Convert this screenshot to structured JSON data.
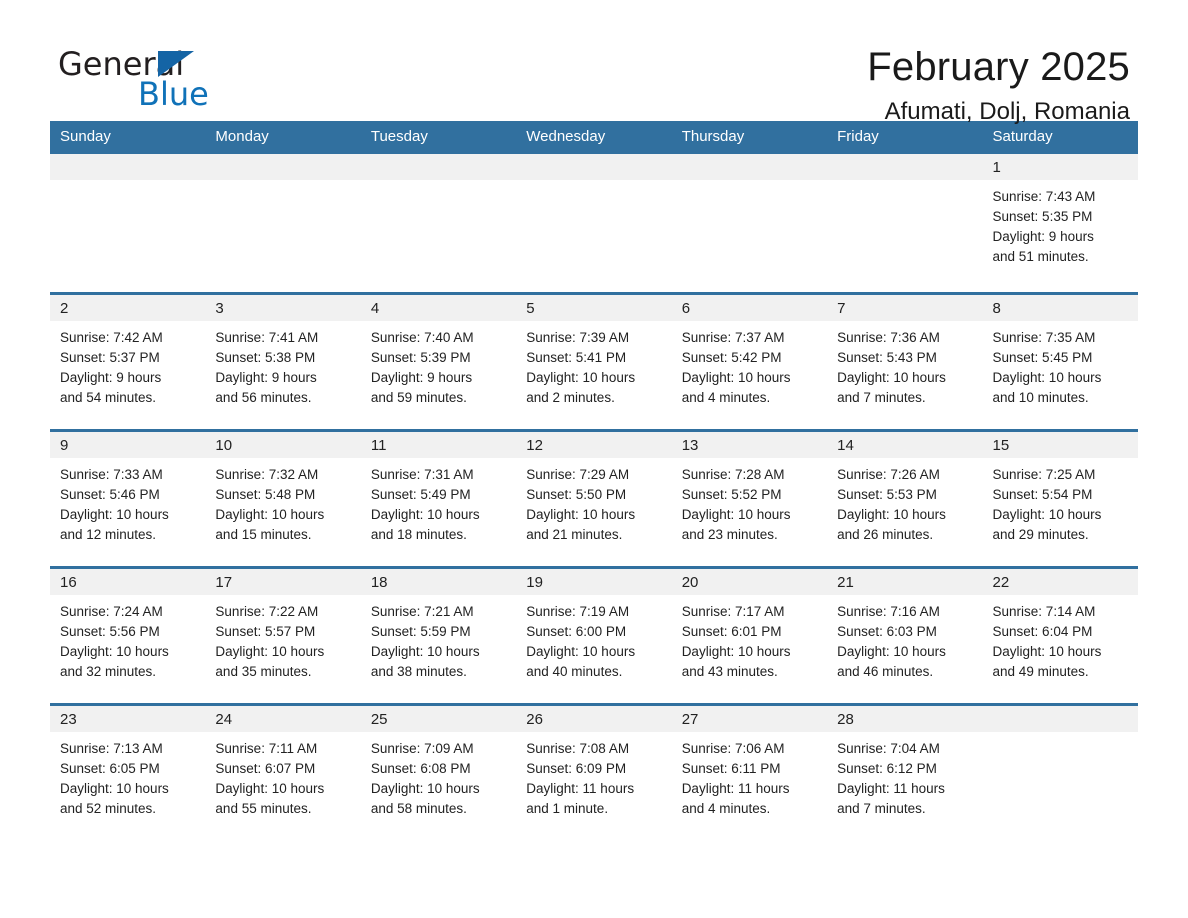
{
  "logo": {
    "part1": "General",
    "part2": "Blue",
    "triangle": "triangle-mark"
  },
  "header": {
    "month_title": "February 2025",
    "location": "Afumati, Dolj, Romania"
  },
  "calendar": {
    "weekdays": [
      "Sunday",
      "Monday",
      "Tuesday",
      "Wednesday",
      "Thursday",
      "Friday",
      "Saturday"
    ],
    "accent_color": "#31709f",
    "daynum_bg": "#f1f1f1",
    "weeks": [
      [
        {
          "day": "",
          "sunrise": "",
          "sunset": "",
          "daylight_line1": "",
          "daylight_line2": ""
        },
        {
          "day": "",
          "sunrise": "",
          "sunset": "",
          "daylight_line1": "",
          "daylight_line2": ""
        },
        {
          "day": "",
          "sunrise": "",
          "sunset": "",
          "daylight_line1": "",
          "daylight_line2": ""
        },
        {
          "day": "",
          "sunrise": "",
          "sunset": "",
          "daylight_line1": "",
          "daylight_line2": ""
        },
        {
          "day": "",
          "sunrise": "",
          "sunset": "",
          "daylight_line1": "",
          "daylight_line2": ""
        },
        {
          "day": "",
          "sunrise": "",
          "sunset": "",
          "daylight_line1": "",
          "daylight_line2": ""
        },
        {
          "day": "1",
          "sunrise": "Sunrise: 7:43 AM",
          "sunset": "Sunset: 5:35 PM",
          "daylight_line1": "Daylight: 9 hours",
          "daylight_line2": "and 51 minutes."
        }
      ],
      [
        {
          "day": "2",
          "sunrise": "Sunrise: 7:42 AM",
          "sunset": "Sunset: 5:37 PM",
          "daylight_line1": "Daylight: 9 hours",
          "daylight_line2": "and 54 minutes."
        },
        {
          "day": "3",
          "sunrise": "Sunrise: 7:41 AM",
          "sunset": "Sunset: 5:38 PM",
          "daylight_line1": "Daylight: 9 hours",
          "daylight_line2": "and 56 minutes."
        },
        {
          "day": "4",
          "sunrise": "Sunrise: 7:40 AM",
          "sunset": "Sunset: 5:39 PM",
          "daylight_line1": "Daylight: 9 hours",
          "daylight_line2": "and 59 minutes."
        },
        {
          "day": "5",
          "sunrise": "Sunrise: 7:39 AM",
          "sunset": "Sunset: 5:41 PM",
          "daylight_line1": "Daylight: 10 hours",
          "daylight_line2": "and 2 minutes."
        },
        {
          "day": "6",
          "sunrise": "Sunrise: 7:37 AM",
          "sunset": "Sunset: 5:42 PM",
          "daylight_line1": "Daylight: 10 hours",
          "daylight_line2": "and 4 minutes."
        },
        {
          "day": "7",
          "sunrise": "Sunrise: 7:36 AM",
          "sunset": "Sunset: 5:43 PM",
          "daylight_line1": "Daylight: 10 hours",
          "daylight_line2": "and 7 minutes."
        },
        {
          "day": "8",
          "sunrise": "Sunrise: 7:35 AM",
          "sunset": "Sunset: 5:45 PM",
          "daylight_line1": "Daylight: 10 hours",
          "daylight_line2": "and 10 minutes."
        }
      ],
      [
        {
          "day": "9",
          "sunrise": "Sunrise: 7:33 AM",
          "sunset": "Sunset: 5:46 PM",
          "daylight_line1": "Daylight: 10 hours",
          "daylight_line2": "and 12 minutes."
        },
        {
          "day": "10",
          "sunrise": "Sunrise: 7:32 AM",
          "sunset": "Sunset: 5:48 PM",
          "daylight_line1": "Daylight: 10 hours",
          "daylight_line2": "and 15 minutes."
        },
        {
          "day": "11",
          "sunrise": "Sunrise: 7:31 AM",
          "sunset": "Sunset: 5:49 PM",
          "daylight_line1": "Daylight: 10 hours",
          "daylight_line2": "and 18 minutes."
        },
        {
          "day": "12",
          "sunrise": "Sunrise: 7:29 AM",
          "sunset": "Sunset: 5:50 PM",
          "daylight_line1": "Daylight: 10 hours",
          "daylight_line2": "and 21 minutes."
        },
        {
          "day": "13",
          "sunrise": "Sunrise: 7:28 AM",
          "sunset": "Sunset: 5:52 PM",
          "daylight_line1": "Daylight: 10 hours",
          "daylight_line2": "and 23 minutes."
        },
        {
          "day": "14",
          "sunrise": "Sunrise: 7:26 AM",
          "sunset": "Sunset: 5:53 PM",
          "daylight_line1": "Daylight: 10 hours",
          "daylight_line2": "and 26 minutes."
        },
        {
          "day": "15",
          "sunrise": "Sunrise: 7:25 AM",
          "sunset": "Sunset: 5:54 PM",
          "daylight_line1": "Daylight: 10 hours",
          "daylight_line2": "and 29 minutes."
        }
      ],
      [
        {
          "day": "16",
          "sunrise": "Sunrise: 7:24 AM",
          "sunset": "Sunset: 5:56 PM",
          "daylight_line1": "Daylight: 10 hours",
          "daylight_line2": "and 32 minutes."
        },
        {
          "day": "17",
          "sunrise": "Sunrise: 7:22 AM",
          "sunset": "Sunset: 5:57 PM",
          "daylight_line1": "Daylight: 10 hours",
          "daylight_line2": "and 35 minutes."
        },
        {
          "day": "18",
          "sunrise": "Sunrise: 7:21 AM",
          "sunset": "Sunset: 5:59 PM",
          "daylight_line1": "Daylight: 10 hours",
          "daylight_line2": "and 38 minutes."
        },
        {
          "day": "19",
          "sunrise": "Sunrise: 7:19 AM",
          "sunset": "Sunset: 6:00 PM",
          "daylight_line1": "Daylight: 10 hours",
          "daylight_line2": "and 40 minutes."
        },
        {
          "day": "20",
          "sunrise": "Sunrise: 7:17 AM",
          "sunset": "Sunset: 6:01 PM",
          "daylight_line1": "Daylight: 10 hours",
          "daylight_line2": "and 43 minutes."
        },
        {
          "day": "21",
          "sunrise": "Sunrise: 7:16 AM",
          "sunset": "Sunset: 6:03 PM",
          "daylight_line1": "Daylight: 10 hours",
          "daylight_line2": "and 46 minutes."
        },
        {
          "day": "22",
          "sunrise": "Sunrise: 7:14 AM",
          "sunset": "Sunset: 6:04 PM",
          "daylight_line1": "Daylight: 10 hours",
          "daylight_line2": "and 49 minutes."
        }
      ],
      [
        {
          "day": "23",
          "sunrise": "Sunrise: 7:13 AM",
          "sunset": "Sunset: 6:05 PM",
          "daylight_line1": "Daylight: 10 hours",
          "daylight_line2": "and 52 minutes."
        },
        {
          "day": "24",
          "sunrise": "Sunrise: 7:11 AM",
          "sunset": "Sunset: 6:07 PM",
          "daylight_line1": "Daylight: 10 hours",
          "daylight_line2": "and 55 minutes."
        },
        {
          "day": "25",
          "sunrise": "Sunrise: 7:09 AM",
          "sunset": "Sunset: 6:08 PM",
          "daylight_line1": "Daylight: 10 hours",
          "daylight_line2": "and 58 minutes."
        },
        {
          "day": "26",
          "sunrise": "Sunrise: 7:08 AM",
          "sunset": "Sunset: 6:09 PM",
          "daylight_line1": "Daylight: 11 hours",
          "daylight_line2": "and 1 minute."
        },
        {
          "day": "27",
          "sunrise": "Sunrise: 7:06 AM",
          "sunset": "Sunset: 6:11 PM",
          "daylight_line1": "Daylight: 11 hours",
          "daylight_line2": "and 4 minutes."
        },
        {
          "day": "28",
          "sunrise": "Sunrise: 7:04 AM",
          "sunset": "Sunset: 6:12 PM",
          "daylight_line1": "Daylight: 11 hours",
          "daylight_line2": "and 7 minutes."
        },
        {
          "day": "",
          "sunrise": "",
          "sunset": "",
          "daylight_line1": "",
          "daylight_line2": ""
        }
      ]
    ]
  }
}
